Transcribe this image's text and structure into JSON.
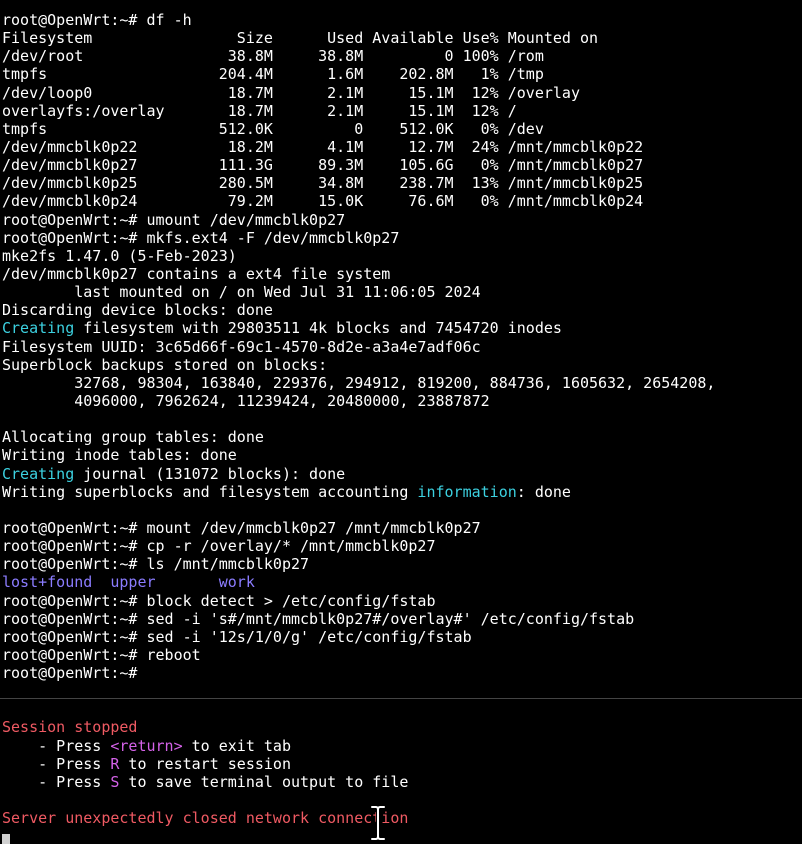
{
  "terminal": {
    "prompt": "root@OpenWrt:~#",
    "lines": [
      {
        "segments": [
          {
            "t": "root@OpenWrt:~# df -h"
          }
        ]
      },
      {
        "segments": [
          {
            "t": "Filesystem                Size      Used Available Use% Mounted on"
          }
        ]
      },
      {
        "segments": [
          {
            "t": "/dev/root                38.8M     38.8M         0 100% /rom"
          }
        ]
      },
      {
        "segments": [
          {
            "t": "tmpfs                   204.4M      1.6M    202.8M   1% /tmp"
          }
        ]
      },
      {
        "segments": [
          {
            "t": "/dev/loop0               18.7M      2.1M     15.1M  12% /overlay"
          }
        ]
      },
      {
        "segments": [
          {
            "t": "overlayfs:/overlay       18.7M      2.1M     15.1M  12% /"
          }
        ]
      },
      {
        "segments": [
          {
            "t": "tmpfs                   512.0K         0    512.0K   0% /dev"
          }
        ]
      },
      {
        "segments": [
          {
            "t": "/dev/mmcblk0p22          18.2M      4.1M     12.7M  24% /mnt/mmcblk0p22"
          }
        ]
      },
      {
        "segments": [
          {
            "t": "/dev/mmcblk0p27         111.3G     89.3M    105.6G   0% /mnt/mmcblk0p27"
          }
        ]
      },
      {
        "segments": [
          {
            "t": "/dev/mmcblk0p25         280.5M     34.8M    238.7M  13% /mnt/mmcblk0p25"
          }
        ]
      },
      {
        "segments": [
          {
            "t": "/dev/mmcblk0p24          79.2M     15.0K     76.6M   0% /mnt/mmcblk0p24"
          }
        ]
      },
      {
        "segments": [
          {
            "t": "root@OpenWrt:~# umount /dev/mmcblk0p27"
          }
        ]
      },
      {
        "segments": [
          {
            "t": "root@OpenWrt:~# mkfs.ext4 -F /dev/mmcblk0p27"
          }
        ]
      },
      {
        "segments": [
          {
            "t": "mke2fs 1.47.0 (5-Feb-2023)"
          }
        ]
      },
      {
        "segments": [
          {
            "t": "/dev/mmcblk0p27 contains a ext4 file system"
          }
        ]
      },
      {
        "segments": [
          {
            "t": "        last mounted on / on Wed Jul 31 11:06:05 2024"
          }
        ]
      },
      {
        "segments": [
          {
            "t": "Discarding device blocks: done"
          }
        ]
      },
      {
        "segments": [
          {
            "t": "Creating",
            "c": "cyan"
          },
          {
            "t": " filesystem with 29803511 4k blocks and 7454720 inodes"
          }
        ]
      },
      {
        "segments": [
          {
            "t": "Filesystem UUID: 3c65d66f-69c1-4570-8d2e-a3a4e7adf06c"
          }
        ]
      },
      {
        "segments": [
          {
            "t": "Superblock backups stored on blocks:"
          }
        ]
      },
      {
        "segments": [
          {
            "t": "        32768, 98304, 163840, 229376, 294912, 819200, 884736, 1605632, 2654208,"
          }
        ]
      },
      {
        "segments": [
          {
            "t": "        4096000, 7962624, 11239424, 20480000, 23887872"
          }
        ]
      },
      {
        "segments": [
          {
            "t": ""
          }
        ]
      },
      {
        "segments": [
          {
            "t": "Allocating group tables: done"
          }
        ]
      },
      {
        "segments": [
          {
            "t": "Writing inode tables: done"
          }
        ]
      },
      {
        "segments": [
          {
            "t": "Creating",
            "c": "cyan"
          },
          {
            "t": " journal (131072 blocks): done"
          }
        ]
      },
      {
        "segments": [
          {
            "t": "Writing superblocks and filesystem accounting "
          },
          {
            "t": "information",
            "c": "cyan"
          },
          {
            "t": ": done"
          }
        ]
      },
      {
        "segments": [
          {
            "t": ""
          }
        ]
      },
      {
        "segments": [
          {
            "t": "root@OpenWrt:~# mount /dev/mmcblk0p27 /mnt/mmcblk0p27"
          }
        ]
      },
      {
        "segments": [
          {
            "t": "root@OpenWrt:~# cp -r /overlay/* /mnt/mmcblk0p27"
          }
        ]
      },
      {
        "segments": [
          {
            "t": "root@OpenWrt:~# ls /mnt/mmcblk0p27"
          }
        ]
      },
      {
        "segments": [
          {
            "t": "lost+found",
            "c": "purple"
          },
          {
            "t": "  "
          },
          {
            "t": "upper",
            "c": "purple"
          },
          {
            "t": "       "
          },
          {
            "t": "work",
            "c": "purple"
          }
        ]
      },
      {
        "segments": [
          {
            "t": "root@OpenWrt:~# block detect > /etc/config/fstab"
          }
        ]
      },
      {
        "segments": [
          {
            "t": "root@OpenWrt:~# sed -i 's#/mnt/mmcblk0p27#/overlay#' /etc/config/fstab"
          }
        ]
      },
      {
        "segments": [
          {
            "t": "root@OpenWrt:~# sed -i '12s/1/0/g' /etc/config/fstab"
          }
        ]
      },
      {
        "segments": [
          {
            "t": "root@OpenWrt:~# reboot"
          }
        ]
      },
      {
        "segments": [
          {
            "t": "root@OpenWrt:~#"
          }
        ]
      },
      {
        "segments": [
          {
            "t": ""
          }
        ]
      },
      {
        "segments": [
          {
            "t": ""
          }
        ]
      },
      {
        "segments": [
          {
            "t": "Session stopped",
            "c": "red"
          }
        ]
      },
      {
        "segments": [
          {
            "t": "    - Press "
          },
          {
            "t": "<return>",
            "c": "magenta"
          },
          {
            "t": " to exit tab"
          }
        ]
      },
      {
        "segments": [
          {
            "t": "    - Press "
          },
          {
            "t": "R",
            "c": "magenta"
          },
          {
            "t": " to restart session"
          }
        ]
      },
      {
        "segments": [
          {
            "t": "    - Press "
          },
          {
            "t": "S",
            "c": "magenta"
          },
          {
            "t": " to save terminal output to file"
          }
        ]
      },
      {
        "segments": [
          {
            "t": ""
          }
        ]
      },
      {
        "segments": [
          {
            "t": "Server unexpectedly closed network connection",
            "c": "red"
          }
        ]
      }
    ]
  },
  "colors": {
    "background": "#000000",
    "foreground": "#ffffff",
    "cyan": "#3cd1e0",
    "purple": "#8b7cff",
    "red": "#ef5a63",
    "magenta": "#d462e8"
  },
  "icons": {
    "mouse_cursor": "text-ibeam-icon",
    "terminal_cursor": "block-cursor-icon"
  }
}
